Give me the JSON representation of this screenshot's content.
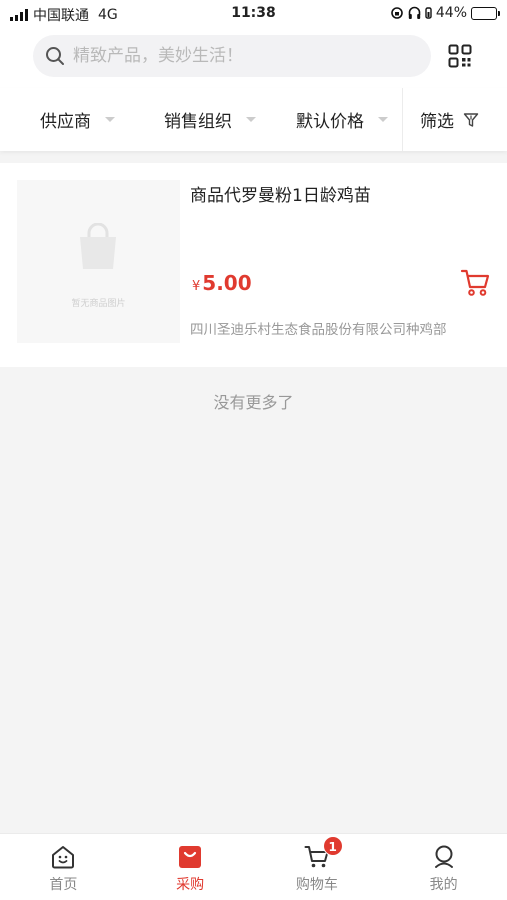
{
  "status_bar": {
    "carrier": "中国联通",
    "network": "4G",
    "time": "11:38",
    "battery": "44%",
    "battery_level": 0.44
  },
  "search": {
    "placeholder": "精致产品，美妙生活！",
    "search_icon": "search-icon",
    "qr_icon": "qr-code-icon"
  },
  "filters": [
    {
      "label": "供应商",
      "icon": "caret-down-icon"
    },
    {
      "label": "销售组织",
      "icon": "caret-down-icon"
    },
    {
      "label": "默认价格",
      "icon": "caret-down-icon"
    },
    {
      "label": "筛选",
      "icon": "filter-icon"
    }
  ],
  "products": [
    {
      "name": "商品代罗曼粉1日龄鸡苗",
      "currency": "¥",
      "price": "5.00",
      "supplier": "四川圣迪乐村生态食品股份有限公司种鸡部",
      "image_placeholder": "暂无商品图片"
    }
  ],
  "list_end_text": "没有更多了",
  "tabs": [
    {
      "label": "首页",
      "icon": "home-icon",
      "active": false
    },
    {
      "label": "采购",
      "icon": "shopping-bag-icon",
      "active": true
    },
    {
      "label": "购物车",
      "icon": "cart-icon",
      "active": false,
      "badge": "1"
    },
    {
      "label": "我的",
      "icon": "user-icon",
      "active": false
    }
  ],
  "colors": {
    "accent": "#e03a2f",
    "background": "#f4f4f4"
  }
}
